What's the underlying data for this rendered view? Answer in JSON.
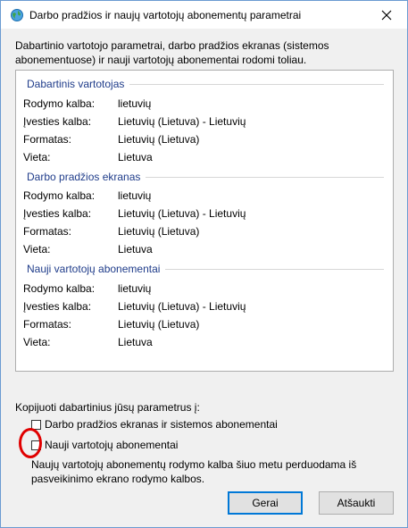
{
  "window": {
    "title": "Darbo pradžios ir naujų vartotojų abonementų parametrai",
    "intro": "Dabartinio vartotojo parametrai, darbo pradžios ekranas (sistemos abonementuose) ir nauji vartotojų abonementai rodomi toliau."
  },
  "sections": [
    {
      "title": "Dabartinis vartotojas",
      "rows": [
        {
          "label": "Rodymo kalba:",
          "value": "lietuvių"
        },
        {
          "label": "Įvesties kalba:",
          "value": "Lietuvių (Lietuva) - Lietuvių"
        },
        {
          "label": "Formatas:",
          "value": "Lietuvių (Lietuva)"
        },
        {
          "label": "Vieta:",
          "value": "Lietuva"
        }
      ]
    },
    {
      "title": "Darbo pradžios ekranas",
      "rows": [
        {
          "label": "Rodymo kalba:",
          "value": "lietuvių"
        },
        {
          "label": "Įvesties kalba:",
          "value": "Lietuvių (Lietuva) - Lietuvių"
        },
        {
          "label": "Formatas:",
          "value": "Lietuvių (Lietuva)"
        },
        {
          "label": "Vieta:",
          "value": "Lietuva"
        }
      ]
    },
    {
      "title": "Nauji vartotojų abonementai",
      "rows": [
        {
          "label": "Rodymo kalba:",
          "value": "lietuvių"
        },
        {
          "label": "Įvesties kalba:",
          "value": "Lietuvių (Lietuva) - Lietuvių"
        },
        {
          "label": "Formatas:",
          "value": "Lietuvių (Lietuva)"
        },
        {
          "label": "Vieta:",
          "value": "Lietuva"
        }
      ]
    }
  ],
  "copy": {
    "label": "Kopijuoti dabartinius jūsų parametrus į:",
    "option_welcome": "Darbo pradžios ekranas ir sistemos abonementai",
    "option_new_users": "Nauji vartotojų abonementai",
    "option_welcome_checked": false,
    "option_new_users_checked": false,
    "note": "Naujų vartotojų abonementų rodymo kalba šiuo metu perduodama iš pasveikinimo ekrano rodymo kalbos."
  },
  "buttons": {
    "ok": "Gerai",
    "cancel": "Atšaukti"
  },
  "colors": {
    "section_title": "#1f3c8a",
    "default_button_border": "#0078d7",
    "annotation": "#e00000"
  }
}
